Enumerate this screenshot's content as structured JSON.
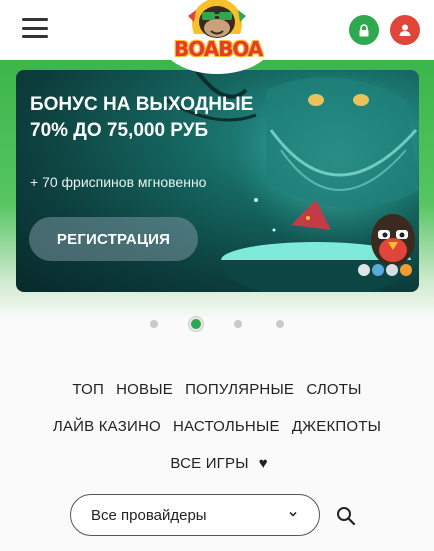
{
  "header": {
    "menu_icon": "hamburger-icon",
    "logo_text": "BOABOA",
    "login_icon": "lock-icon",
    "register_icon": "user-icon",
    "colors": {
      "login": "#2fa84f",
      "register": "#e0453a",
      "green": "#3cb54a"
    }
  },
  "banner": {
    "title": "БОНУС НА ВЫХОДНЫЕ 70% ДО 75,000 РУБ",
    "subtitle": "+ 70 фриспинов мгновенно",
    "cta_label": "РЕГИСТРАЦИЯ",
    "crypto_icons": [
      "litecoin-icon",
      "tether-icon",
      "ripple-icon",
      "bitcoin-icon"
    ]
  },
  "carousel": {
    "slides": 4,
    "active_index": 1
  },
  "categories": {
    "row1": [
      "ТОП",
      "НОВЫЕ",
      "ПОПУЛЯРНЫЕ",
      "СЛОТЫ"
    ],
    "row2": [
      "ЛАЙВ КАЗИНО",
      "НАСТОЛЬНЫЕ",
      "ДЖЕКПОТЫ"
    ],
    "row3": [
      "ВСЕ ИГРЫ"
    ],
    "favorites_icon": "heart-icon"
  },
  "filters": {
    "provider_value": "Все провайдеры",
    "search_icon": "search-icon"
  }
}
